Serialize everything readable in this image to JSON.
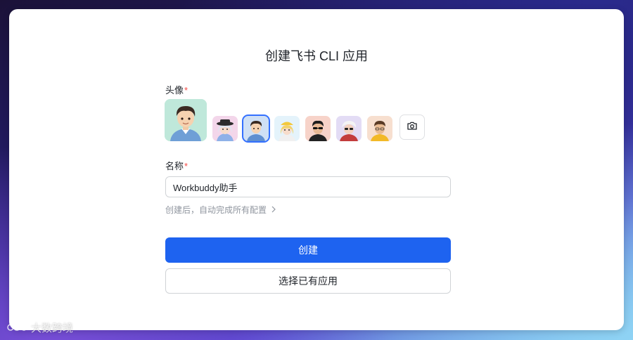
{
  "dialog": {
    "title": "创建飞书 CLI 应用"
  },
  "avatar_field": {
    "label": "头像",
    "required_mark": "*",
    "options": [
      {
        "name": "avatar-option-girl-white-hat",
        "bg": "#f3d6ea"
      },
      {
        "name": "avatar-option-boy-selected",
        "bg": "#cfe0f5"
      },
      {
        "name": "avatar-option-blonde-cap",
        "bg": "#e4f3fb"
      },
      {
        "name": "avatar-option-sunglasses",
        "bg": "#f7d3c9"
      },
      {
        "name": "avatar-option-white-hair",
        "bg": "#e3dcf5"
      },
      {
        "name": "avatar-option-yellow-jacket",
        "bg": "#f7dfcf"
      }
    ],
    "upload_icon": "camera-icon"
  },
  "name_field": {
    "label": "名称",
    "required_mark": "*",
    "value": "Workbuddy助手"
  },
  "hint": {
    "text": "创建后，自动完成所有配置",
    "icon": "chevron-right-icon"
  },
  "buttons": {
    "create": "创建",
    "select_existing": "选择已有应用"
  },
  "watermark": {
    "text": "大数跨境"
  },
  "colors": {
    "primary": "#1e63f0",
    "required": "#f54a45",
    "hint": "#8f959e"
  }
}
